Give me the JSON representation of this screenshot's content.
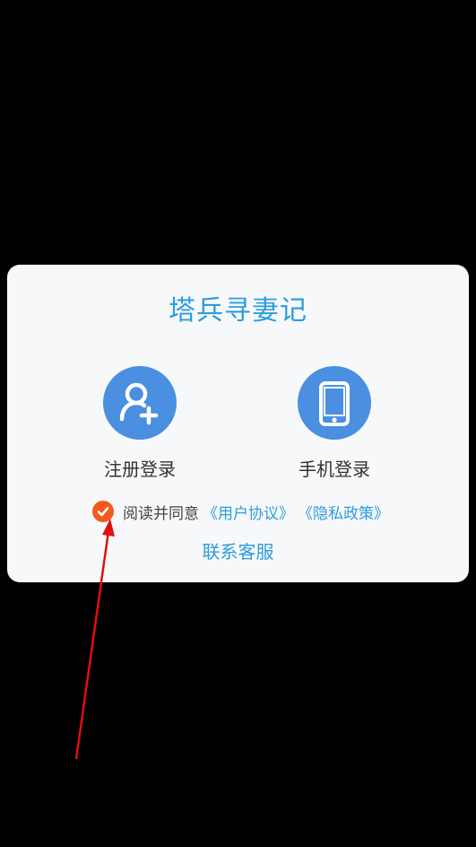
{
  "dialog": {
    "title": "塔兵寻妻记",
    "options": [
      {
        "label": "注册登录",
        "icon": "user-add-icon"
      },
      {
        "label": "手机登录",
        "icon": "phone-icon"
      }
    ],
    "agreement": {
      "checked": true,
      "text": "阅读并同意",
      "user_agreement": "《用户协议》",
      "privacy_policy": "《隐私政策》"
    },
    "contact_label": "联系客服"
  },
  "colors": {
    "accent": "#2c9ddd",
    "icon_bg": "#4a8fe0",
    "check": "#f25a1c",
    "annotation_arrow": "#e01010"
  }
}
